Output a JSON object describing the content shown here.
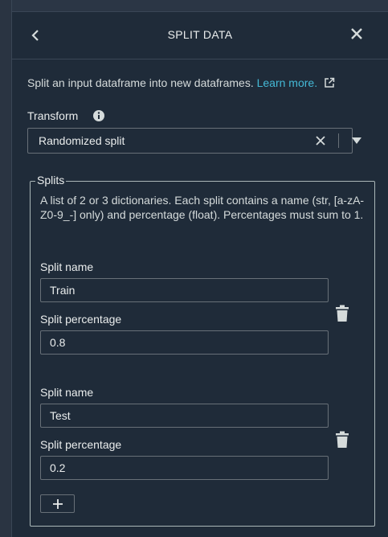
{
  "header": {
    "title": "SPLIT DATA"
  },
  "description": {
    "text": "Split an input dataframe into new dataframes.",
    "link_label": "Learn more."
  },
  "transform": {
    "label": "Transform",
    "selected_value": "Randomized split"
  },
  "splits": {
    "legend": "Splits",
    "description": "A list of 2 or 3 dictionaries. Each split contains a name (str, [a-zA-Z0-9_-] only) and percentage (float). Percentages must sum to 1.",
    "items": [
      {
        "name_label": "Split name",
        "name_value": "Train",
        "percentage_label": "Split percentage",
        "percentage_value": "0.8"
      },
      {
        "name_label": "Split name",
        "name_value": "Test",
        "percentage_label": "Split percentage",
        "percentage_value": "0.2"
      }
    ]
  },
  "colors": {
    "background": "#1f2b39",
    "link": "#44b9d6",
    "text": "#eaeded",
    "border": "#687078"
  }
}
